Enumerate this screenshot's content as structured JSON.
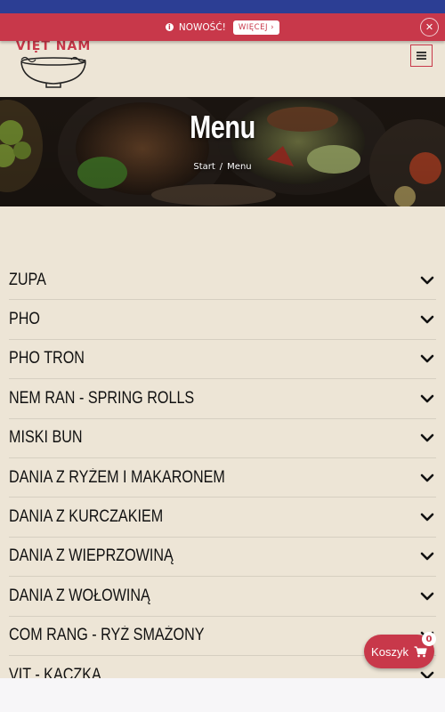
{
  "notice": {
    "icon": "info-icon",
    "label": "NOWOŚĆ!",
    "more_button": "WIĘCEJ ›",
    "close_icon": "close-icon"
  },
  "header": {
    "logo_text": "VIỆT NAM",
    "menu_icon": "hamburger-icon"
  },
  "hero": {
    "title": "Menu",
    "breadcrumb": {
      "home": "Start",
      "separator": "/",
      "current": "Menu"
    }
  },
  "categories": [
    "ZUPA",
    "PHO",
    "PHO TRON",
    "NEM RAN - SPRING ROLLS",
    "MISKI BUN",
    "DANIA Z RYŻEM I MAKARONEM",
    "DANIA Z KURCZAKIEM",
    "DANIA Z WIEPRZOWINĄ",
    "DANIA Z WOŁOWINĄ",
    "COM RANG - RYŻ SMAŻONY",
    "VIT - KACZKA"
  ],
  "cart": {
    "label": "Koszyk",
    "icon": "cart-icon",
    "count": "0"
  },
  "colors": {
    "accent": "#c8384a",
    "top_bar": "#2c3e94",
    "background": "#ede5d6"
  }
}
